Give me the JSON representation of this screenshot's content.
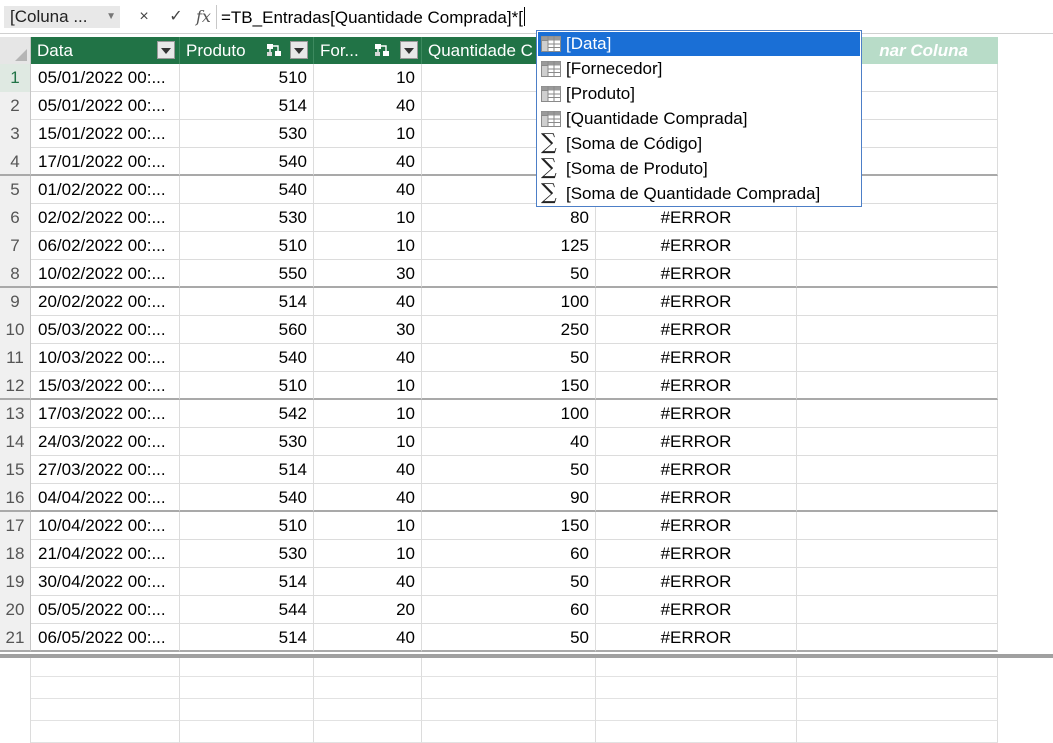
{
  "formula_bar": {
    "name_box": "[Coluna ...",
    "cancel_glyph": "×",
    "confirm_glyph": "✓",
    "fx_label": "fx",
    "formula": "=TB_Entradas[Quantidade Comprada]*["
  },
  "columns": [
    {
      "label": "Data",
      "has_filter": true
    },
    {
      "label": "Produto",
      "has_filter": true,
      "relationship_icon": true
    },
    {
      "label": "For...",
      "has_filter": true,
      "relationship_icon": true
    },
    {
      "label": "Quantidade C",
      "has_filter": false
    },
    {
      "label": "",
      "has_filter": false
    }
  ],
  "add_column_label": "nar Coluna",
  "rows": [
    {
      "n": "1",
      "data": "05/01/2022 00:...",
      "produto": "510",
      "fornecedor": "10",
      "quantidade": "",
      "calc": ""
    },
    {
      "n": "2",
      "data": "05/01/2022 00:...",
      "produto": "514",
      "fornecedor": "40",
      "quantidade": "",
      "calc": ""
    },
    {
      "n": "3",
      "data": "15/01/2022 00:...",
      "produto": "530",
      "fornecedor": "10",
      "quantidade": "",
      "calc": ""
    },
    {
      "n": "4",
      "data": "17/01/2022 00:...",
      "produto": "540",
      "fornecedor": "40",
      "quantidade": "",
      "calc": ""
    },
    {
      "n": "5",
      "data": "01/02/2022 00:...",
      "produto": "540",
      "fornecedor": "40",
      "quantidade": "",
      "calc": ""
    },
    {
      "n": "6",
      "data": "02/02/2022 00:...",
      "produto": "530",
      "fornecedor": "10",
      "quantidade": "80",
      "calc": "#ERROR"
    },
    {
      "n": "7",
      "data": "06/02/2022 00:...",
      "produto": "510",
      "fornecedor": "10",
      "quantidade": "125",
      "calc": "#ERROR"
    },
    {
      "n": "8",
      "data": "10/02/2022 00:...",
      "produto": "550",
      "fornecedor": "30",
      "quantidade": "50",
      "calc": "#ERROR"
    },
    {
      "n": "9",
      "data": "20/02/2022 00:...",
      "produto": "514",
      "fornecedor": "40",
      "quantidade": "100",
      "calc": "#ERROR"
    },
    {
      "n": "10",
      "data": "05/03/2022 00:...",
      "produto": "560",
      "fornecedor": "30",
      "quantidade": "250",
      "calc": "#ERROR"
    },
    {
      "n": "11",
      "data": "10/03/2022 00:...",
      "produto": "540",
      "fornecedor": "40",
      "quantidade": "50",
      "calc": "#ERROR"
    },
    {
      "n": "12",
      "data": "15/03/2022 00:...",
      "produto": "510",
      "fornecedor": "10",
      "quantidade": "150",
      "calc": "#ERROR"
    },
    {
      "n": "13",
      "data": "17/03/2022 00:...",
      "produto": "542",
      "fornecedor": "10",
      "quantidade": "100",
      "calc": "#ERROR"
    },
    {
      "n": "14",
      "data": "24/03/2022 00:...",
      "produto": "530",
      "fornecedor": "10",
      "quantidade": "40",
      "calc": "#ERROR"
    },
    {
      "n": "15",
      "data": "27/03/2022 00:...",
      "produto": "514",
      "fornecedor": "40",
      "quantidade": "50",
      "calc": "#ERROR"
    },
    {
      "n": "16",
      "data": "04/04/2022 00:...",
      "produto": "540",
      "fornecedor": "40",
      "quantidade": "90",
      "calc": "#ERROR"
    },
    {
      "n": "17",
      "data": "10/04/2022 00:...",
      "produto": "510",
      "fornecedor": "10",
      "quantidade": "150",
      "calc": "#ERROR"
    },
    {
      "n": "18",
      "data": "21/04/2022 00:...",
      "produto": "530",
      "fornecedor": "10",
      "quantidade": "60",
      "calc": "#ERROR"
    },
    {
      "n": "19",
      "data": "30/04/2022 00:...",
      "produto": "514",
      "fornecedor": "40",
      "quantidade": "50",
      "calc": "#ERROR"
    },
    {
      "n": "20",
      "data": "05/05/2022 00:...",
      "produto": "544",
      "fornecedor": "20",
      "quantidade": "60",
      "calc": "#ERROR"
    },
    {
      "n": "21",
      "data": "06/05/2022 00:...",
      "produto": "514",
      "fornecedor": "40",
      "quantidade": "50",
      "calc": "#ERROR"
    }
  ],
  "autocomplete": {
    "items": [
      {
        "label": "[Data]",
        "icon": "table-column-icon",
        "selected": true
      },
      {
        "label": "[Fornecedor]",
        "icon": "table-column-icon",
        "selected": false
      },
      {
        "label": "[Produto]",
        "icon": "table-column-icon",
        "selected": false
      },
      {
        "label": "[Quantidade Comprada]",
        "icon": "table-column-icon",
        "selected": false
      },
      {
        "label": "[Soma de Código]",
        "icon": "sigma-measure-icon",
        "selected": false
      },
      {
        "label": "[Soma de Produto]",
        "icon": "sigma-measure-icon",
        "selected": false
      },
      {
        "label": "[Soma de Quantidade Comprada]",
        "icon": "sigma-measure-icon",
        "selected": false
      }
    ]
  },
  "colors": {
    "header_green": "#217346",
    "add_column_green": "#b8dcc8",
    "selection_blue": "#1a6fd6"
  }
}
